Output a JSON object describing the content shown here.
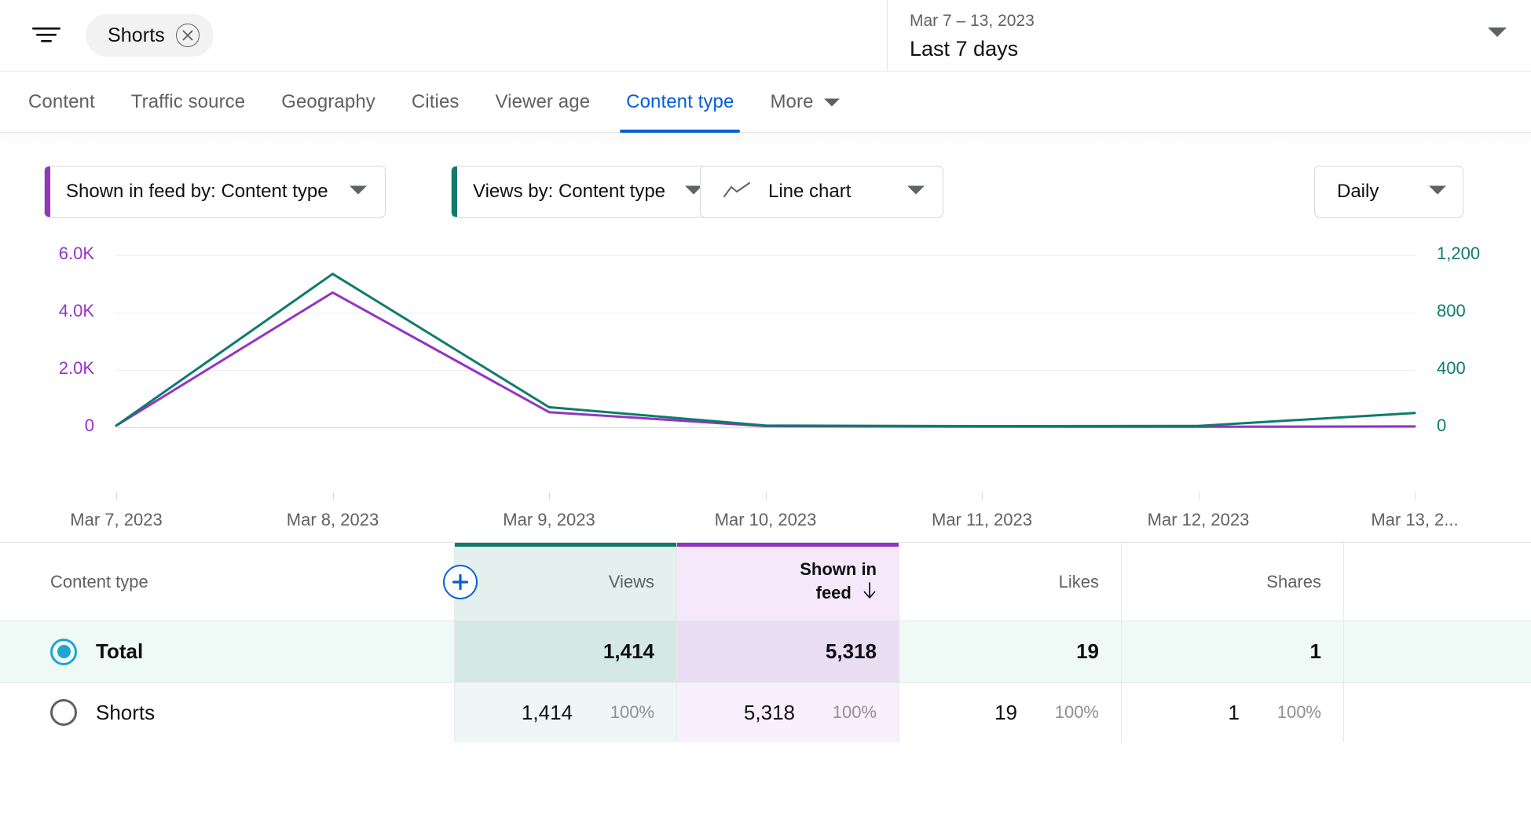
{
  "topbar": {
    "filter_icon": "filter-icon",
    "chip": {
      "label": "Shorts",
      "remove_icon": "close-icon"
    },
    "date_range": {
      "range": "Mar 7 – 13, 2023",
      "preset": "Last 7 days",
      "caret_icon": "chevron-down-icon"
    }
  },
  "tabs": [
    {
      "label": "Content",
      "active": false
    },
    {
      "label": "Traffic source",
      "active": false
    },
    {
      "label": "Geography",
      "active": false
    },
    {
      "label": "Cities",
      "active": false
    },
    {
      "label": "Viewer age",
      "active": false
    },
    {
      "label": "Content type",
      "active": true
    },
    {
      "label": "More",
      "active": false
    }
  ],
  "controls": {
    "shown_in_feed_selector": {
      "label": "Shown in feed by: Content type",
      "accent": "#9334c4"
    },
    "views_selector": {
      "label": "Views by: Content type",
      "accent": "#0f7b6c"
    },
    "chart_type": {
      "label": "Line chart",
      "icon": "line-chart-icon"
    },
    "granularity": {
      "label": "Daily"
    }
  },
  "colors": {
    "purple": "#9334c4",
    "teal": "#0f7b6c",
    "blue": "#065fd4",
    "radio_blue": "#1ea4d3",
    "views_bg": "#e4f0ed",
    "feed_bg": "#f4e8fa",
    "total_row_bg": "#effaf7"
  },
  "chart_data": {
    "type": "line",
    "title": "",
    "x": [
      "Mar 7, 2023",
      "Mar 8, 2023",
      "Mar 9, 2023",
      "Mar 10, 2023",
      "Mar 11, 2023",
      "Mar 12, 2023",
      "Mar 13, 2..."
    ],
    "xlabel": "",
    "grid": true,
    "legend": "none",
    "axes": [
      {
        "name": "Shown in feed",
        "side": "left",
        "color": "#9334c4",
        "ticks": [
          "0",
          "2.0K",
          "4.0K",
          "6.0K"
        ],
        "tick_values": [
          0,
          2000,
          4000,
          6000
        ],
        "ylim": [
          0,
          6600
        ]
      },
      {
        "name": "Views",
        "side": "right",
        "color": "#0f7b6c",
        "ticks": [
          "0",
          "400",
          "800",
          "1,200"
        ],
        "tick_values": [
          0,
          400,
          800,
          1200
        ],
        "ylim": [
          0,
          1320
        ]
      }
    ],
    "series": [
      {
        "name": "Shown in feed",
        "axis": "left",
        "color": "#9334c4",
        "values": [
          60,
          4700,
          530,
          40,
          25,
          20,
          30
        ]
      },
      {
        "name": "Views",
        "axis": "right",
        "color": "#0f7b6c",
        "values": [
          12,
          1070,
          140,
          12,
          8,
          10,
          100
        ]
      }
    ]
  },
  "table": {
    "columns": [
      {
        "key": "name",
        "label": "Content type",
        "align": "left",
        "accent": null,
        "bg": null,
        "sorted": false
      },
      {
        "key": "views",
        "label": "Views",
        "align": "right",
        "accent": "#0f7b6c",
        "bg": "#e4f0ed",
        "sorted": false
      },
      {
        "key": "feed",
        "label": "Shown in feed",
        "label_line1": "Shown in",
        "label_line2": "feed",
        "align": "right",
        "accent": "#9334c4",
        "bg": "#f4e8fa",
        "sorted": true,
        "sort_icon": "arrow-down-icon"
      },
      {
        "key": "likes",
        "label": "Likes",
        "align": "right",
        "accent": null,
        "bg": null,
        "sorted": false
      },
      {
        "key": "shares",
        "label": "Shares",
        "align": "right",
        "accent": null,
        "bg": null,
        "sorted": false
      }
    ],
    "add_column_button": "plus-icon",
    "rows": [
      {
        "name": "Total",
        "selected": true,
        "is_total": true,
        "views": "1,414",
        "views_pct": "",
        "feed": "5,318",
        "feed_pct": "",
        "likes": "19",
        "likes_pct": "",
        "shares": "1",
        "shares_pct": ""
      },
      {
        "name": "Shorts",
        "selected": false,
        "is_total": false,
        "views": "1,414",
        "views_pct": "100%",
        "feed": "5,318",
        "feed_pct": "100%",
        "likes": "19",
        "likes_pct": "100%",
        "shares": "1",
        "shares_pct": "100%"
      }
    ]
  }
}
